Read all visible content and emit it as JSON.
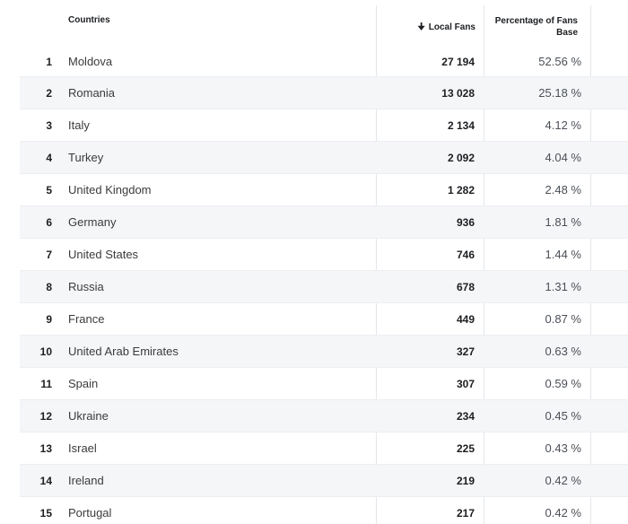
{
  "table": {
    "headers": {
      "countries": "Countries",
      "local_fans": "Local Fans",
      "local_fans_icon": "sort-down-icon",
      "percentage": "Percentage of Fans Base"
    },
    "rows": [
      {
        "rank": "1",
        "country": "Moldova",
        "fans": "27 194",
        "pct": "52.56 %"
      },
      {
        "rank": "2",
        "country": "Romania",
        "fans": "13 028",
        "pct": "25.18 %"
      },
      {
        "rank": "3",
        "country": "Italy",
        "fans": "2 134",
        "pct": "4.12 %"
      },
      {
        "rank": "4",
        "country": "Turkey",
        "fans": "2 092",
        "pct": "4.04 %"
      },
      {
        "rank": "5",
        "country": "United Kingdom",
        "fans": "1 282",
        "pct": "2.48 %"
      },
      {
        "rank": "6",
        "country": "Germany",
        "fans": "936",
        "pct": "1.81 %"
      },
      {
        "rank": "7",
        "country": "United States",
        "fans": "746",
        "pct": "1.44 %"
      },
      {
        "rank": "8",
        "country": "Russia",
        "fans": "678",
        "pct": "1.31 %"
      },
      {
        "rank": "9",
        "country": "France",
        "fans": "449",
        "pct": "0.87 %"
      },
      {
        "rank": "10",
        "country": "United Arab Emirates",
        "fans": "327",
        "pct": "0.63 %"
      },
      {
        "rank": "11",
        "country": "Spain",
        "fans": "307",
        "pct": "0.59 %"
      },
      {
        "rank": "12",
        "country": "Ukraine",
        "fans": "234",
        "pct": "0.45 %"
      },
      {
        "rank": "13",
        "country": "Israel",
        "fans": "225",
        "pct": "0.43 %"
      },
      {
        "rank": "14",
        "country": "Ireland",
        "fans": "219",
        "pct": "0.42 %"
      },
      {
        "rank": "15",
        "country": "Portugal",
        "fans": "217",
        "pct": "0.42 %"
      }
    ]
  },
  "colors": {
    "row_alt": "#f5f6f8",
    "divider": "#e4e6eb",
    "text": "#1c1e21"
  }
}
